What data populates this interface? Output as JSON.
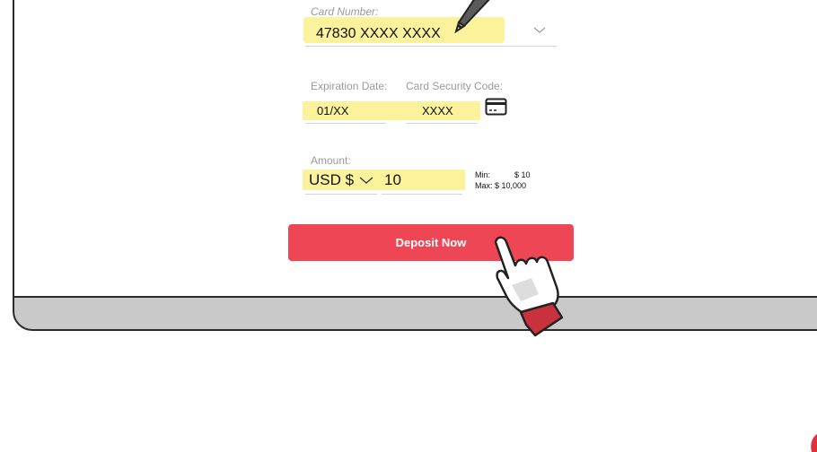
{
  "form": {
    "card_number_label": "Card Number:",
    "card_number_value": "47830 XXXX XXXX",
    "expiration_label": "Expiration Date:",
    "security_label": "Card Security Code:",
    "expiration_value": "01/XX",
    "security_value": "XXXX",
    "amount_label": "Amount:",
    "currency_value": "USD $",
    "amount_value": "10",
    "min_label": "Min:",
    "min_value": "$ 10",
    "max_text": "Max: $ 10,000"
  },
  "deposit_button_label": "Deposit Now",
  "colors": {
    "accent": "#ee4654",
    "highlight": "#fbf29b",
    "cuff": "#c9323c"
  }
}
